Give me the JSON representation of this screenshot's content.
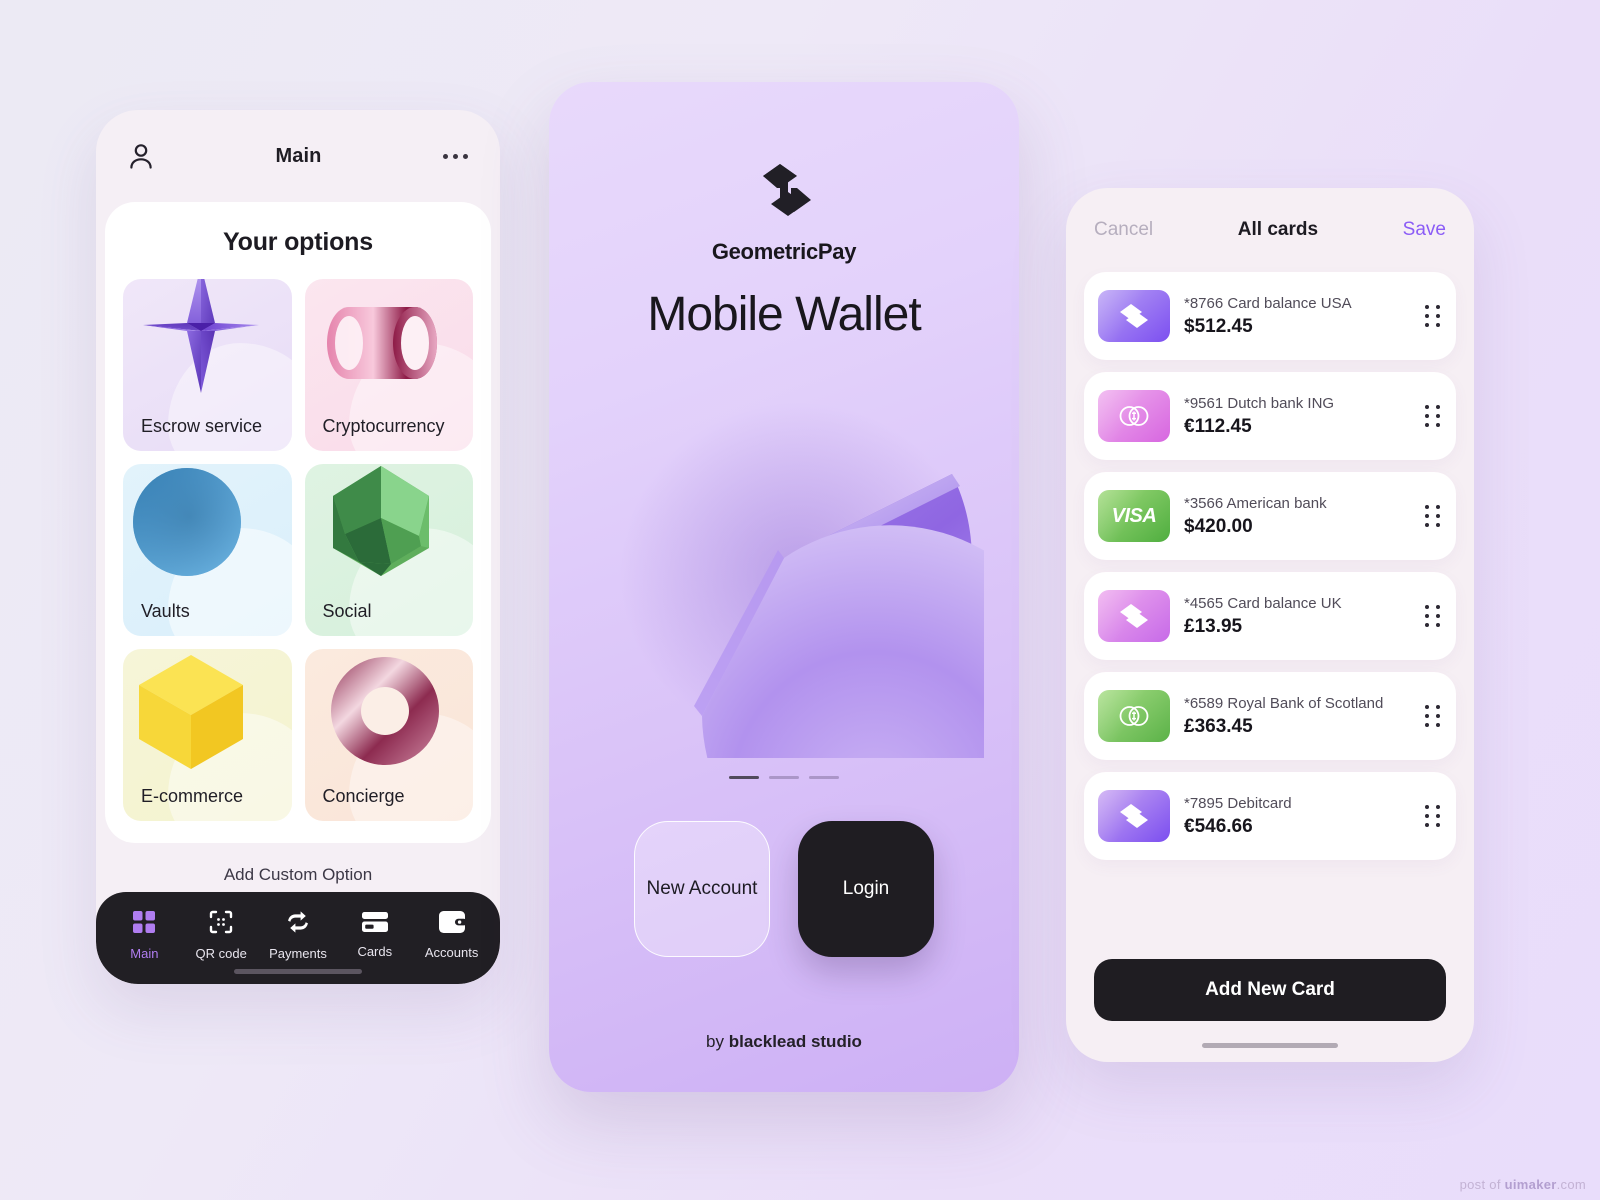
{
  "left_phone": {
    "topbar": {
      "profile_icon": "person-icon",
      "title": "Main",
      "more_icon": "ellipsis-icon"
    },
    "card_title": "Your options",
    "options": [
      {
        "label": "Escrow service",
        "art": "purple-star-tetrahedron"
      },
      {
        "label": "Cryptocurrency",
        "art": "pink-cylinder-ring"
      },
      {
        "label": "Vaults",
        "art": "blue-sphere-cone"
      },
      {
        "label": "Social",
        "art": "green-dodecahedron"
      },
      {
        "label": "E-commerce",
        "art": "yellow-cube"
      },
      {
        "label": "Concierge",
        "art": "maroon-torus"
      }
    ],
    "add_custom_label": "Add Custom Option",
    "tabs": [
      {
        "label": "Main",
        "icon": "grid-icon",
        "active": true
      },
      {
        "label": "QR code",
        "icon": "qr-code-icon",
        "active": false
      },
      {
        "label": "Payments",
        "icon": "transfer-arrows-icon",
        "active": false
      },
      {
        "label": "Cards",
        "icon": "credit-card-icon",
        "active": false
      },
      {
        "label": "Accounts",
        "icon": "wallet-icon",
        "active": false
      }
    ]
  },
  "center_phone": {
    "logo_icon": "geometricpay-logo-icon",
    "brand_name": "GeometricPay",
    "hero_title": "Mobile Wallet",
    "hero_art": "purple-split-disc-3d",
    "pager": {
      "total": 3,
      "active_index": 0
    },
    "new_account_label": "New Account",
    "login_label": "Login",
    "credit_prefix": "by ",
    "credit_studio": "blacklead studio"
  },
  "right_phone": {
    "topbar": {
      "cancel_label": "Cancel",
      "title": "All cards",
      "save_label": "Save"
    },
    "cards": [
      {
        "name": "*8766 Card balance USA",
        "amount": "$512.45",
        "brand_icon": "geometricpay-logo-icon",
        "chip": "chip-violet"
      },
      {
        "name": "*9561 Dutch bank ING",
        "amount": "€112.45",
        "brand_icon": "mastercard-icon",
        "chip": "chip-pink"
      },
      {
        "name": "*3566 American bank",
        "amount": "$420.00",
        "brand_icon": "visa-icon",
        "chip": "chip-green"
      },
      {
        "name": "*4565 Card balance UK",
        "amount": "£13.95",
        "brand_icon": "geometricpay-logo-icon",
        "chip": "chip-orchid"
      },
      {
        "name": "*6589 Royal Bank of Scotland",
        "amount": "£363.45",
        "brand_icon": "mastercard-icon",
        "chip": "chip-green2"
      },
      {
        "name": "*7895 Debitcard",
        "amount": "€546.66",
        "brand_icon": "geometricpay-logo-icon",
        "chip": "chip-violet2"
      }
    ],
    "visa_text": "VISA",
    "add_new_card_label": "Add New Card"
  },
  "watermark": {
    "prefix": "post of ",
    "brand": "uimaker",
    "suffix": ".com"
  },
  "colors": {
    "accent_purple": "#8b5cf6",
    "tab_active": "#b07df0",
    "dark": "#1f1d22",
    "page_bg_start": "#eceaf4",
    "page_bg_end": "#e9ddfb"
  }
}
